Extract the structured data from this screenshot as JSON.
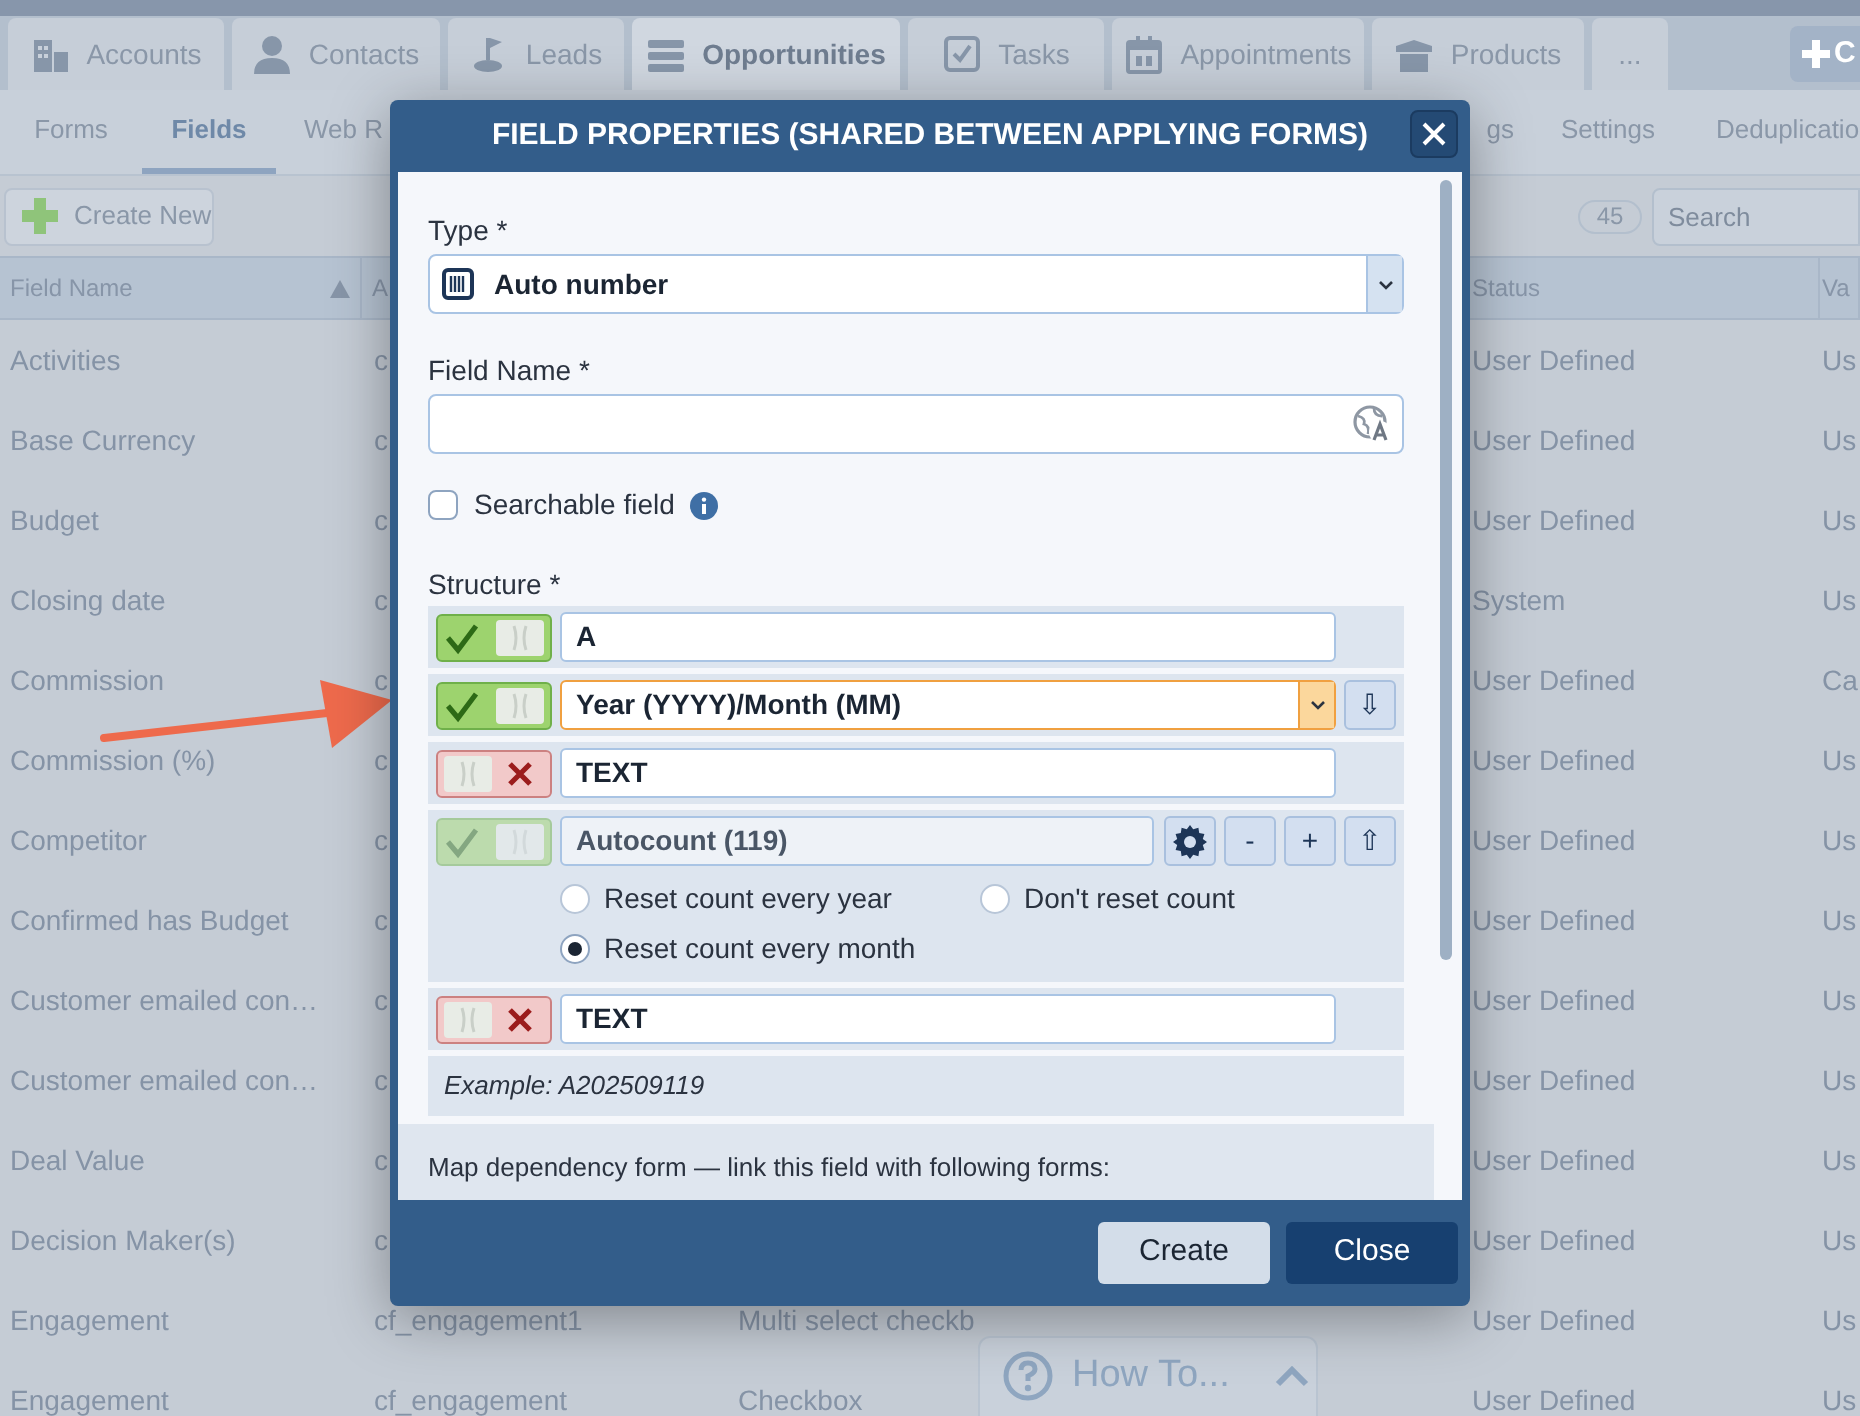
{
  "tabs": [
    {
      "label": "Accounts",
      "selected": false
    },
    {
      "label": "Contacts",
      "selected": false
    },
    {
      "label": "Leads",
      "selected": false
    },
    {
      "label": "Opportunities",
      "selected": true
    },
    {
      "label": "Tasks",
      "selected": false
    },
    {
      "label": "Appointments",
      "selected": false
    },
    {
      "label": "Products",
      "selected": false
    },
    {
      "label": "...",
      "selected": false
    }
  ],
  "add_button": {
    "label": "C"
  },
  "subtabs": [
    {
      "label": "Forms",
      "selected": false
    },
    {
      "label": "Fields",
      "selected": true
    },
    {
      "label": "Web R",
      "selected": false
    },
    {
      "label": "gs",
      "selected": false
    },
    {
      "label": "Settings",
      "selected": false
    },
    {
      "label": "Deduplicatio",
      "selected": false
    }
  ],
  "toolbar": {
    "create_button": "Create New",
    "count": "45",
    "search_placeholder": "Search"
  },
  "table": {
    "columns": [
      {
        "label": "Field Name",
        "sorted": true
      },
      {
        "label": "A",
        "sorted": false
      },
      {
        "label": "Status",
        "sorted": false
      },
      {
        "label": "Va",
        "sorted": false
      }
    ],
    "rows": [
      {
        "field_name": "Activities",
        "column_2": "c",
        "status": "User Defined",
        "column_6": "Us"
      },
      {
        "field_name": "Base Currency",
        "column_2": "c",
        "status": "User Defined",
        "column_6": "Us"
      },
      {
        "field_name": "Budget",
        "column_2": "c",
        "status": "User Defined",
        "column_6": "Us"
      },
      {
        "field_name": "Closing date",
        "column_2": "c",
        "status": "System",
        "column_6": "Us"
      },
      {
        "field_name": "Commission",
        "column_2": "c",
        "status": "User Defined",
        "column_6": "Ca"
      },
      {
        "field_name": "Commission (%)",
        "column_2": "c",
        "status": "User Defined",
        "column_6": "Us"
      },
      {
        "field_name": "Competitor",
        "column_2": "c",
        "status": "User Defined",
        "column_6": "Us"
      },
      {
        "field_name": "Confirmed has Budget",
        "column_2": "c",
        "status": "User Defined",
        "column_6": "Us"
      },
      {
        "field_name": "Customer emailed con…",
        "column_2": "c",
        "status": "User Defined",
        "column_6": "Us"
      },
      {
        "field_name": "Customer emailed con…",
        "column_2": "c",
        "status": "User Defined",
        "column_6": "Us"
      },
      {
        "field_name": "Deal Value",
        "column_2": "c",
        "status": "User Defined",
        "column_6": "Us"
      },
      {
        "field_name": "Decision Maker(s)",
        "column_2": "c",
        "status": "User Defined",
        "column_6": "Us"
      },
      {
        "field_name": "Engagement",
        "column_2": "cf_engagement1",
        "column_3": "Multi select checkb",
        "status": "User Defined",
        "column_6": "Us"
      },
      {
        "field_name": "Engagement",
        "column_2": "cf_engagement",
        "column_3": "Checkbox",
        "status": "User Defined",
        "column_6": "Us"
      }
    ]
  },
  "help_widget": {
    "label": "How To...",
    "expanded": false
  },
  "dialog": {
    "title": "FIELD PROPERTIES (SHARED BETWEEN APPLYING FORMS)",
    "type": {
      "label": "Type *",
      "value": "Auto number"
    },
    "field_name": {
      "label": "Field Name *"
    },
    "searchable": {
      "label": "Searchable field",
      "checked": false
    },
    "structure": {
      "label": "Structure *",
      "parts": [
        {
          "kind": "text",
          "enabled": true,
          "disabled": false,
          "focused": false,
          "value": "A"
        },
        {
          "kind": "select",
          "enabled": true,
          "disabled": false,
          "focused": true,
          "value": "Year (YYYY)/Month (MM)",
          "buttons": [
            {
              "kind": "text",
              "label": "⇩"
            }
          ]
        },
        {
          "kind": "text",
          "enabled": false,
          "disabled": false,
          "focused": false,
          "value": "TEXT"
        },
        {
          "kind": "counter",
          "enabled": true,
          "disabled": true,
          "focused": false,
          "value": "Autocount (119)",
          "buttons": [
            {
              "kind": "gear"
            },
            {
              "kind": "text",
              "label": "-"
            },
            {
              "kind": "text",
              "label": "+"
            },
            {
              "kind": "text",
              "label": "⇧"
            }
          ],
          "options": [
            {
              "label": "Reset count every year",
              "selected": false
            },
            {
              "label": "Don't reset count",
              "selected": false
            },
            {
              "label": "Reset count every month",
              "selected": true
            }
          ]
        },
        {
          "kind": "text",
          "enabled": false,
          "disabled": false,
          "focused": false,
          "value": "TEXT"
        }
      ],
      "example": "Example: A202509119"
    },
    "map_dependency": "Map dependency form — link this field with following forms:",
    "buttons": [
      {
        "label": "Create",
        "primary": false
      },
      {
        "label": "Close",
        "primary": true
      }
    ]
  }
}
